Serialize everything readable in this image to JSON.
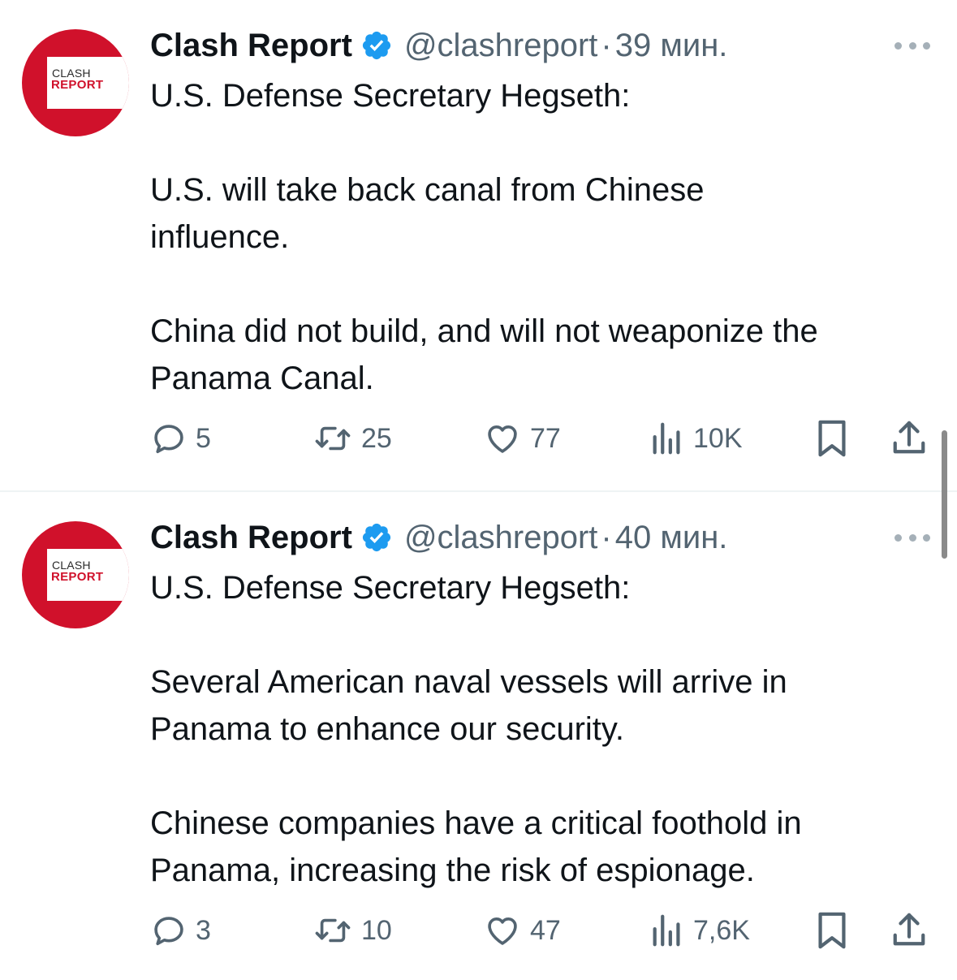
{
  "tweets": [
    {
      "author": {
        "name": "Clash Report",
        "handle": "@clashreport",
        "avatar_text_top": "CLASH",
        "avatar_text_bottom": "REPORT",
        "verified_icon": "verified-badge-icon"
      },
      "separator": "·",
      "time": "39 мин.",
      "paragraphs": [
        "U.S. Defense Secretary Hegseth:",
        "U.S. will take back canal from Chinese influence.",
        "China did not build, and will not weaponize the Panama Canal."
      ],
      "stats": {
        "replies": "5",
        "retweets": "25",
        "likes": "77",
        "views": "10K"
      }
    },
    {
      "author": {
        "name": "Clash Report",
        "handle": "@clashreport",
        "avatar_text_top": "CLASH",
        "avatar_text_bottom": "REPORT",
        "verified_icon": "verified-badge-icon"
      },
      "separator": "·",
      "time": "40 мин.",
      "paragraphs": [
        "U.S. Defense Secretary Hegseth:",
        "Several American naval vessels will arrive in Panama to enhance our security.",
        "Chinese companies have a critical foothold in Panama, increasing the risk of espionage."
      ],
      "stats": {
        "replies": "3",
        "retweets": "10",
        "likes": "47",
        "views": "7,6K"
      }
    }
  ],
  "colors": {
    "text_primary": "#0f1419",
    "text_secondary": "#536471",
    "verified_blue": "#1d9bf0",
    "avatar_red": "#d0112b",
    "divider": "#eff3f4"
  },
  "icons": [
    "reply-icon",
    "retweet-icon",
    "like-icon",
    "views-icon",
    "bookmark-icon",
    "share-icon",
    "more-icon"
  ]
}
